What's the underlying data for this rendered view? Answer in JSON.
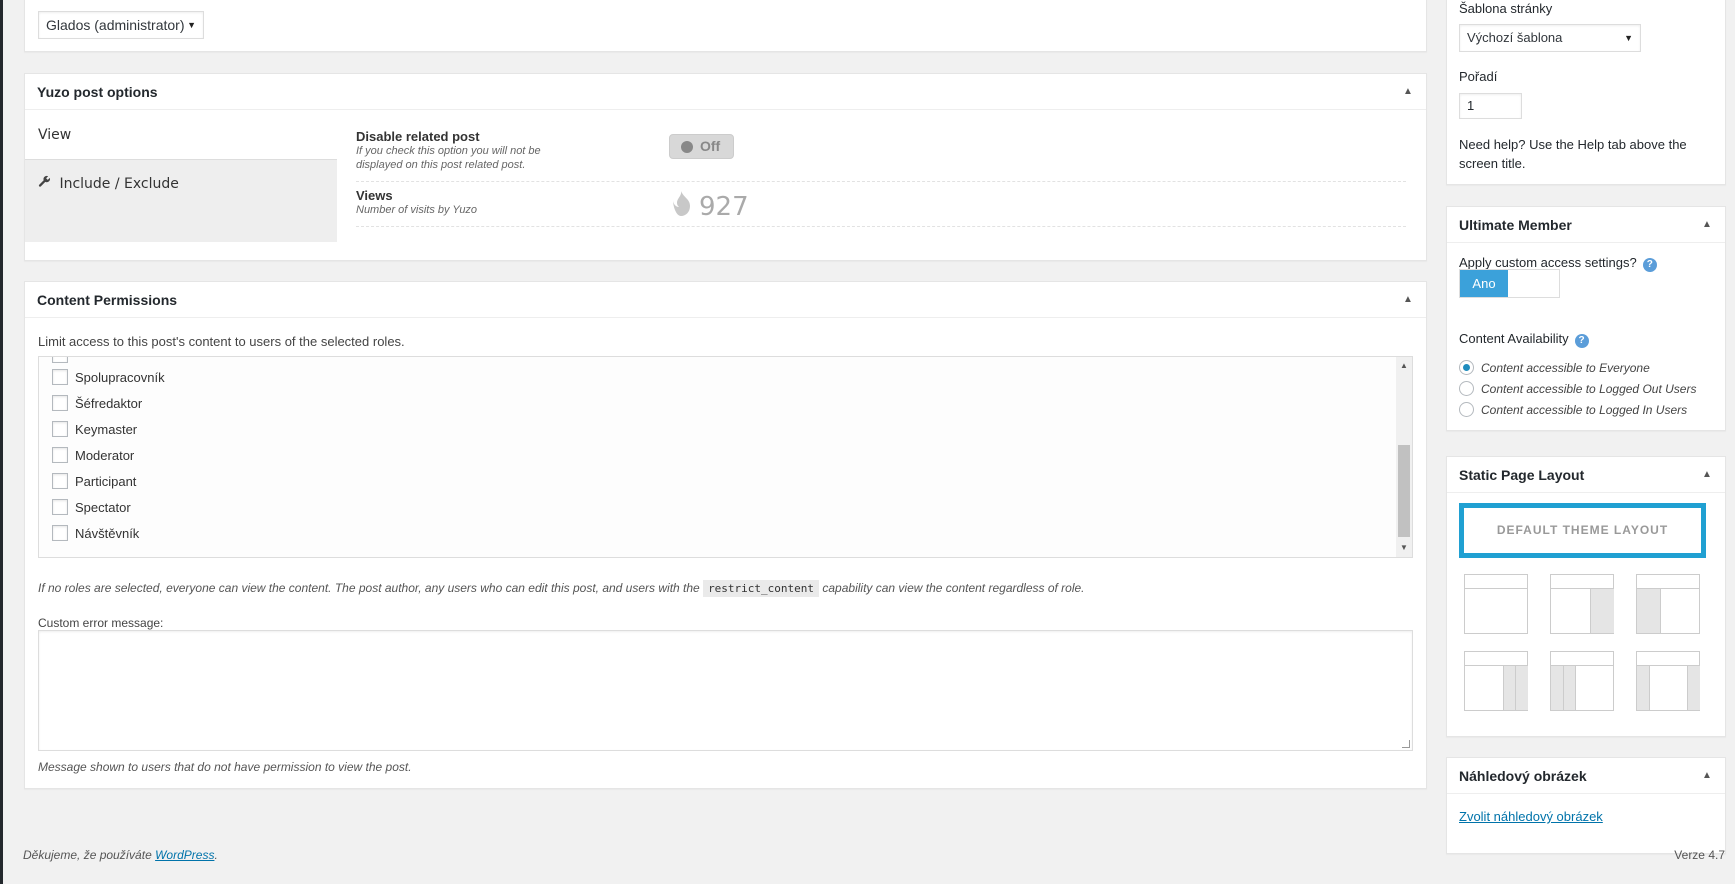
{
  "author_metabox": {
    "selected_author": "Glados (administrator)"
  },
  "yuzo": {
    "title": "Yuzo post options",
    "tabs": [
      {
        "label": "View"
      },
      {
        "label": "Include / Exclude"
      }
    ],
    "disable_related": {
      "label": "Disable related post",
      "desc_line1": "If you check this option you will not be",
      "desc_line2": "displayed on this post related post.",
      "toggle_label": "Off"
    },
    "views": {
      "label": "Views",
      "desc": "Number of visits by Yuzo",
      "count": "927"
    }
  },
  "content_permissions": {
    "title": "Content Permissions",
    "intro": "Limit access to this post's content to users of the selected roles.",
    "roles": [
      {
        "label": "Spolupracovník",
        "checked": false
      },
      {
        "label": "Šéfredaktor",
        "checked": false
      },
      {
        "label": "Keymaster",
        "checked": false
      },
      {
        "label": "Moderator",
        "checked": false
      },
      {
        "label": "Participant",
        "checked": false
      },
      {
        "label": "Spectator",
        "checked": false
      },
      {
        "label": "Návštěvník",
        "checked": false
      }
    ],
    "note_before": "If no roles are selected, everyone can view the content. The post author, any users who can edit this post, and users with the",
    "note_code": "restrict_content",
    "note_after": "capability can view the content regardless of role.",
    "custom_error_label": "Custom error message:",
    "custom_error_value": "",
    "custom_error_hint": "Message shown to users that do not have permission to view the post."
  },
  "page_attributes": {
    "template_label": "Šablona stránky",
    "template_value": "Výchozí šablona",
    "order_label": "Pořadí",
    "order_value": "1",
    "help_text": "Need help? Use the Help tab above the screen title."
  },
  "ultimate_member": {
    "title": "Ultimate Member",
    "apply_label": "Apply custom access settings?",
    "toggle_on": "Ano",
    "availability_label": "Content Availability",
    "options": [
      {
        "label": "Content accessible to Everyone",
        "checked": true
      },
      {
        "label": "Content accessible to Logged Out Users",
        "checked": false
      },
      {
        "label": "Content accessible to Logged In Users",
        "checked": false
      }
    ]
  },
  "static_layout": {
    "title": "Static Page Layout",
    "default_label": "DEFAULT THEME LAYOUT"
  },
  "featured_image": {
    "title": "Náhledový obrázek",
    "link": "Zvolit náhledový obrázek"
  },
  "footer": {
    "thanks_prefix": "Děkujeme, že používáte",
    "wp_link": "WordPress",
    "thanks_suffix": ".",
    "version": "Verze 4.7"
  },
  "colors": {
    "accent": "#0073aa",
    "toggle_on": "#3ba1da",
    "layout_selected": "#20a0d2"
  }
}
